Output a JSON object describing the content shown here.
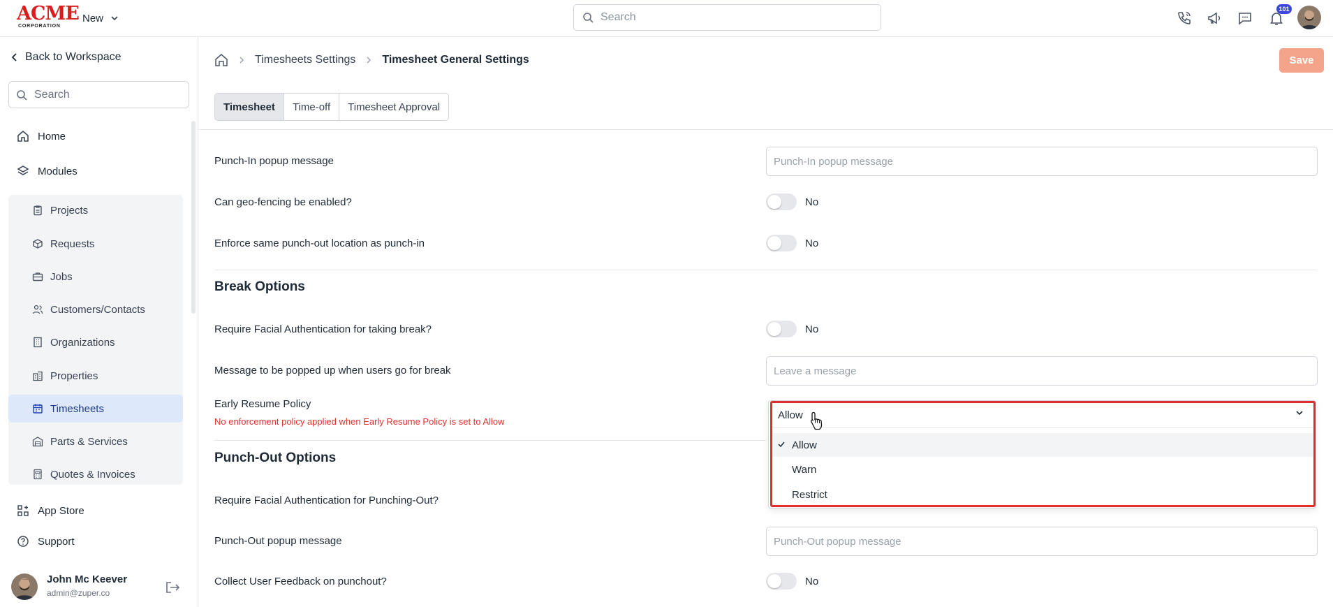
{
  "topbar": {
    "logo_word": "ACME",
    "logo_sub": "CORPORATION",
    "new_label": "New",
    "search_placeholder": "Search",
    "notification_count": "101"
  },
  "sidebar": {
    "back_label": "Back to Workspace",
    "search_placeholder": "Search",
    "home_label": "Home",
    "modules_label": "Modules",
    "modules": [
      {
        "label": "Projects",
        "icon": "clipboard-icon"
      },
      {
        "label": "Requests",
        "icon": "box-icon"
      },
      {
        "label": "Jobs",
        "icon": "briefcase-icon"
      },
      {
        "label": "Customers/Contacts",
        "icon": "users-icon"
      },
      {
        "label": "Organizations",
        "icon": "building-icon"
      },
      {
        "label": "Properties",
        "icon": "buildings-icon"
      },
      {
        "label": "Timesheets",
        "icon": "calendar-icon",
        "active": true
      },
      {
        "label": "Parts & Services",
        "icon": "warehouse-icon"
      },
      {
        "label": "Quotes & Invoices",
        "icon": "calculator-icon"
      }
    ],
    "app_store_label": "App Store",
    "support_label": "Support",
    "user": {
      "name": "John Mc Keever",
      "email": "admin@zuper.co"
    }
  },
  "breadcrumb": {
    "parent": "Timesheets Settings",
    "current": "Timesheet General Settings"
  },
  "save_label": "Save",
  "tabs": [
    {
      "label": "Timesheet",
      "active": true
    },
    {
      "label": "Time-off"
    },
    {
      "label": "Timesheet Approval"
    }
  ],
  "settings": {
    "punch_in_popup": {
      "label": "Punch-In popup message",
      "placeholder": "Punch-In popup message"
    },
    "geo_fencing": {
      "label": "Can geo-fencing be enabled?",
      "value": "No"
    },
    "enforce_location": {
      "label": "Enforce same punch-out location as punch-in",
      "value": "No"
    },
    "break_section": "Break Options",
    "break_facial": {
      "label": "Require Facial Authentication for taking break?",
      "value": "No"
    },
    "break_message": {
      "label": "Message to be popped up when users go for break",
      "placeholder": "Leave a message"
    },
    "early_resume": {
      "label": "Early Resume Policy",
      "note": "No enforcement policy applied when Early Resume Policy is set to Allow",
      "selected": "Allow",
      "options": [
        "Allow",
        "Warn",
        "Restrict"
      ]
    },
    "punch_out_section": "Punch-Out Options",
    "punch_out_facial": {
      "label": "Require Facial Authentication for Punching-Out?"
    },
    "punch_out_popup": {
      "label": "Punch-Out popup message",
      "placeholder": "Punch-Out popup message"
    },
    "user_feedback": {
      "label": "Collect User Feedback on punchout?",
      "value": "No"
    }
  },
  "colors": {
    "accent_active_bg": "#dde9fa",
    "save_button": "#f3a48b",
    "warning_text": "#e0322f",
    "highlight_border": "#e02c2c",
    "badge": "#3b48d8"
  }
}
